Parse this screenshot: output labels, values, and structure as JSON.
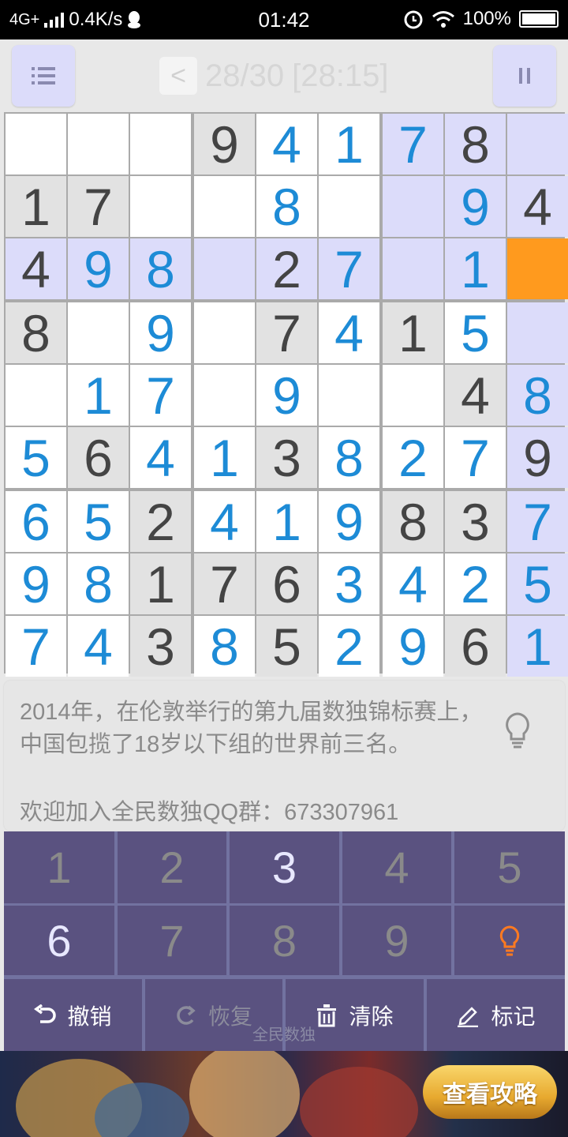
{
  "status_bar": {
    "network": "4G+",
    "speed": "0.4K/s",
    "time": "01:42",
    "battery": "100%"
  },
  "header": {
    "back_label": "<",
    "progress": "28/30",
    "timer": "[28:15]"
  },
  "colors": {
    "highlight": "#dcdcfa",
    "given_bg": "#e2e2e2",
    "selected": "#ff9a1e",
    "user_digit": "#1d8bd6",
    "given_digit": "#444444",
    "keypad_bg": "#5a5280"
  },
  "board": {
    "selected": [
      2,
      8
    ],
    "rows": [
      [
        "",
        "",
        "",
        "9",
        "4",
        "1",
        "7",
        "8",
        ""
      ],
      [
        "1",
        "7",
        "",
        "",
        "8",
        "",
        "",
        "9",
        "4"
      ],
      [
        "4",
        "9",
        "8",
        "",
        "2",
        "7",
        "",
        "1",
        ""
      ],
      [
        "8",
        "",
        "9",
        "",
        "7",
        "4",
        "1",
        "5",
        ""
      ],
      [
        "",
        "1",
        "7",
        "",
        "9",
        "",
        "",
        "4",
        "8"
      ],
      [
        "5",
        "6",
        "4",
        "1",
        "3",
        "8",
        "2",
        "7",
        "9"
      ],
      [
        "6",
        "5",
        "2",
        "4",
        "1",
        "9",
        "8",
        "3",
        "7"
      ],
      [
        "9",
        "8",
        "1",
        "7",
        "6",
        "3",
        "4",
        "2",
        "5"
      ],
      [
        "7",
        "4",
        "3",
        "8",
        "5",
        "2",
        "9",
        "6",
        "1"
      ]
    ],
    "kind": [
      [
        "e",
        "e",
        "e",
        "g",
        "u",
        "u",
        "u",
        "g",
        "e"
      ],
      [
        "g",
        "g",
        "e",
        "e",
        "u",
        "e",
        "e",
        "u",
        "g"
      ],
      [
        "g",
        "u",
        "u",
        "e",
        "g",
        "u",
        "e",
        "u",
        "e"
      ],
      [
        "g",
        "e",
        "u",
        "e",
        "g",
        "u",
        "g",
        "u",
        "e"
      ],
      [
        "e",
        "u",
        "u",
        "e",
        "u",
        "e",
        "e",
        "g",
        "u"
      ],
      [
        "u",
        "g",
        "u",
        "u",
        "g",
        "u",
        "u",
        "u",
        "g"
      ],
      [
        "u",
        "u",
        "g",
        "u",
        "u",
        "u",
        "g",
        "g",
        "u"
      ],
      [
        "u",
        "u",
        "g",
        "g",
        "g",
        "u",
        "u",
        "u",
        "u"
      ],
      [
        "u",
        "u",
        "g",
        "u",
        "g",
        "u",
        "u",
        "g",
        "u"
      ]
    ]
  },
  "hint": {
    "text": "2014年，在伦敦举行的第九届数独锦标赛上，中国包揽了18岁以下组的世界前三名。",
    "qq": "欢迎加入全民数独QQ群：673307961"
  },
  "keypad": {
    "keys": [
      {
        "label": "1",
        "active": false
      },
      {
        "label": "2",
        "active": false
      },
      {
        "label": "3",
        "active": true
      },
      {
        "label": "4",
        "active": false
      },
      {
        "label": "5",
        "active": false
      },
      {
        "label": "6",
        "active": true
      },
      {
        "label": "7",
        "active": false
      },
      {
        "label": "8",
        "active": false
      },
      {
        "label": "9",
        "active": false
      }
    ],
    "actions": {
      "undo": "撤销",
      "redo": "恢复",
      "clear": "清除",
      "mark": "标记"
    },
    "watermark": "全民数独"
  },
  "ad": {
    "button_label": "查看攻略"
  }
}
